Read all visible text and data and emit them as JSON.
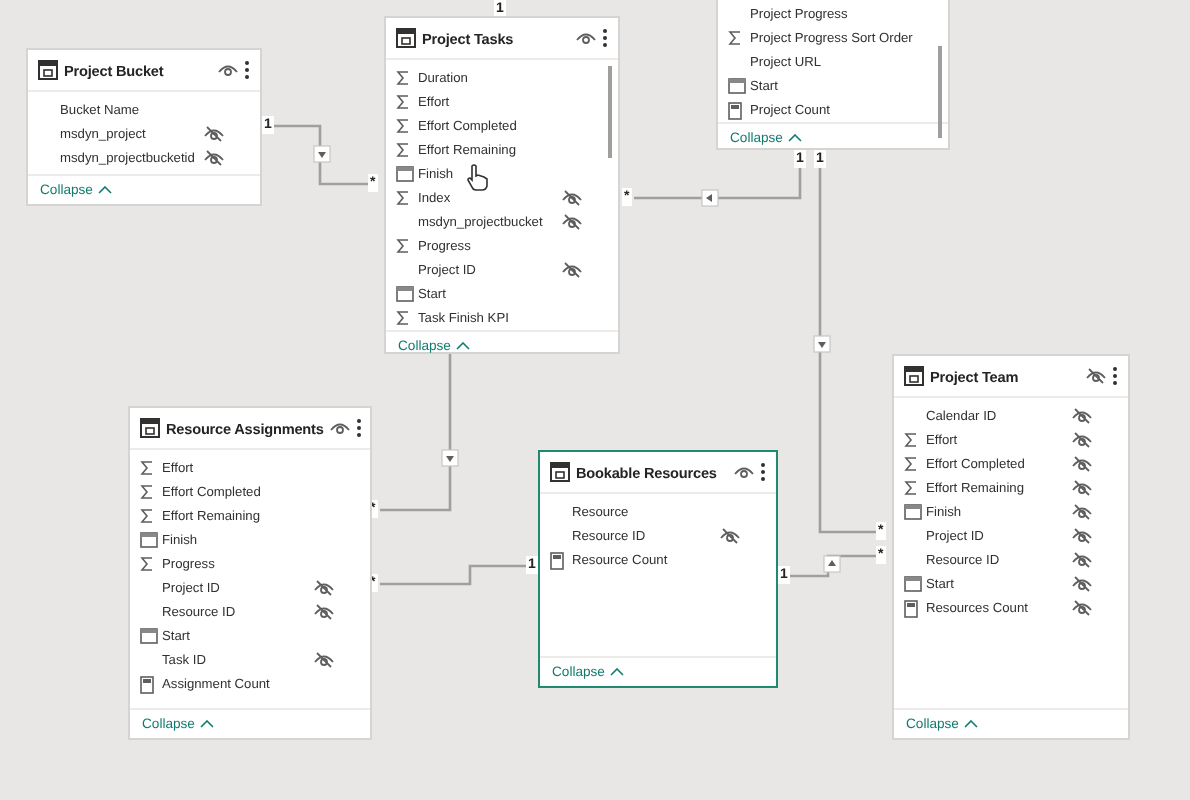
{
  "tables": [
    {
      "name": "Project Bucket",
      "hidden": false,
      "selected": false,
      "collapse": "Collapse",
      "scrollbar": false,
      "fields": [
        {
          "name": "Bucket Name",
          "kind": "plain",
          "hidden": false
        },
        {
          "name": "msdyn_project",
          "kind": "plain",
          "hidden": true
        },
        {
          "name": "msdyn_projectbucketid",
          "kind": "plain",
          "hidden": true
        }
      ]
    },
    {
      "name": "Project Tasks",
      "hidden": false,
      "selected": false,
      "collapse": "Collapse",
      "scrollbar": true,
      "fields": [
        {
          "name": "Duration",
          "kind": "sum",
          "hidden": false
        },
        {
          "name": "Effort",
          "kind": "sum",
          "hidden": false
        },
        {
          "name": "Effort Completed",
          "kind": "sum",
          "hidden": false
        },
        {
          "name": "Effort Remaining",
          "kind": "sum",
          "hidden": false
        },
        {
          "name": "Finish",
          "kind": "date",
          "hidden": false
        },
        {
          "name": "Index",
          "kind": "sum",
          "hidden": true
        },
        {
          "name": "msdyn_projectbucket",
          "kind": "plain",
          "hidden": true
        },
        {
          "name": "Progress",
          "kind": "sum",
          "hidden": false
        },
        {
          "name": "Project ID",
          "kind": "plain",
          "hidden": true
        },
        {
          "name": "Start",
          "kind": "date",
          "hidden": false
        },
        {
          "name": "Task Finish KPI",
          "kind": "sum",
          "hidden": false
        }
      ]
    },
    {
      "collapse": "Collapse",
      "selected": false,
      "scrollbar": true,
      "fields": [
        {
          "name": "Project Progress",
          "kind": "plain",
          "hidden": false
        },
        {
          "name": "Project Progress Sort Order",
          "kind": "sum",
          "hidden": false
        },
        {
          "name": "Project URL",
          "kind": "plain",
          "hidden": false
        },
        {
          "name": "Start",
          "kind": "date",
          "hidden": false
        },
        {
          "name": "Project Count",
          "kind": "measure",
          "hidden": false
        }
      ]
    },
    {
      "name": "Resource Assignments",
      "hidden": false,
      "selected": false,
      "collapse": "Collapse",
      "scrollbar": false,
      "fields": [
        {
          "name": "Effort",
          "kind": "sum",
          "hidden": false
        },
        {
          "name": "Effort Completed",
          "kind": "sum",
          "hidden": false
        },
        {
          "name": "Effort Remaining",
          "kind": "sum",
          "hidden": false
        },
        {
          "name": "Finish",
          "kind": "date",
          "hidden": false
        },
        {
          "name": "Progress",
          "kind": "sum",
          "hidden": false
        },
        {
          "name": "Project ID",
          "kind": "plain",
          "hidden": true
        },
        {
          "name": "Resource ID",
          "kind": "plain",
          "hidden": true
        },
        {
          "name": "Start",
          "kind": "date",
          "hidden": false
        },
        {
          "name": "Task ID",
          "kind": "plain",
          "hidden": true
        },
        {
          "name": "Assignment Count",
          "kind": "measure",
          "hidden": false
        }
      ]
    },
    {
      "name": "Bookable Resources",
      "hidden": false,
      "selected": true,
      "collapse": "Collapse",
      "scrollbar": false,
      "fields": [
        {
          "name": "Resource",
          "kind": "plain",
          "hidden": false
        },
        {
          "name": "Resource ID",
          "kind": "plain",
          "hidden": true
        },
        {
          "name": "Resource Count",
          "kind": "measure",
          "hidden": false
        }
      ]
    },
    {
      "name": "Project Team",
      "hidden": true,
      "selected": false,
      "collapse": "Collapse",
      "scrollbar": false,
      "fields": [
        {
          "name": "Calendar ID",
          "kind": "plain",
          "hidden": true
        },
        {
          "name": "Effort",
          "kind": "sum",
          "hidden": true
        },
        {
          "name": "Effort Completed",
          "kind": "sum",
          "hidden": true
        },
        {
          "name": "Effort Remaining",
          "kind": "sum",
          "hidden": true
        },
        {
          "name": "Finish",
          "kind": "date",
          "hidden": true
        },
        {
          "name": "Project ID",
          "kind": "plain",
          "hidden": true
        },
        {
          "name": "Resource ID",
          "kind": "plain",
          "hidden": true
        },
        {
          "name": "Start",
          "kind": "date",
          "hidden": true
        },
        {
          "name": "Resources Count",
          "kind": "measure",
          "hidden": true
        }
      ]
    }
  ],
  "relationships": [
    {
      "labels": [
        "1",
        "*"
      ]
    },
    {
      "labels": [
        "1"
      ]
    },
    {
      "labels": [
        "*",
        "1"
      ]
    },
    {
      "labels": [
        "1",
        "*"
      ]
    },
    {
      "labels": [
        "*"
      ]
    },
    {
      "labels": [
        "1",
        "*"
      ]
    },
    {
      "labels": [
        "1",
        "*"
      ]
    }
  ]
}
